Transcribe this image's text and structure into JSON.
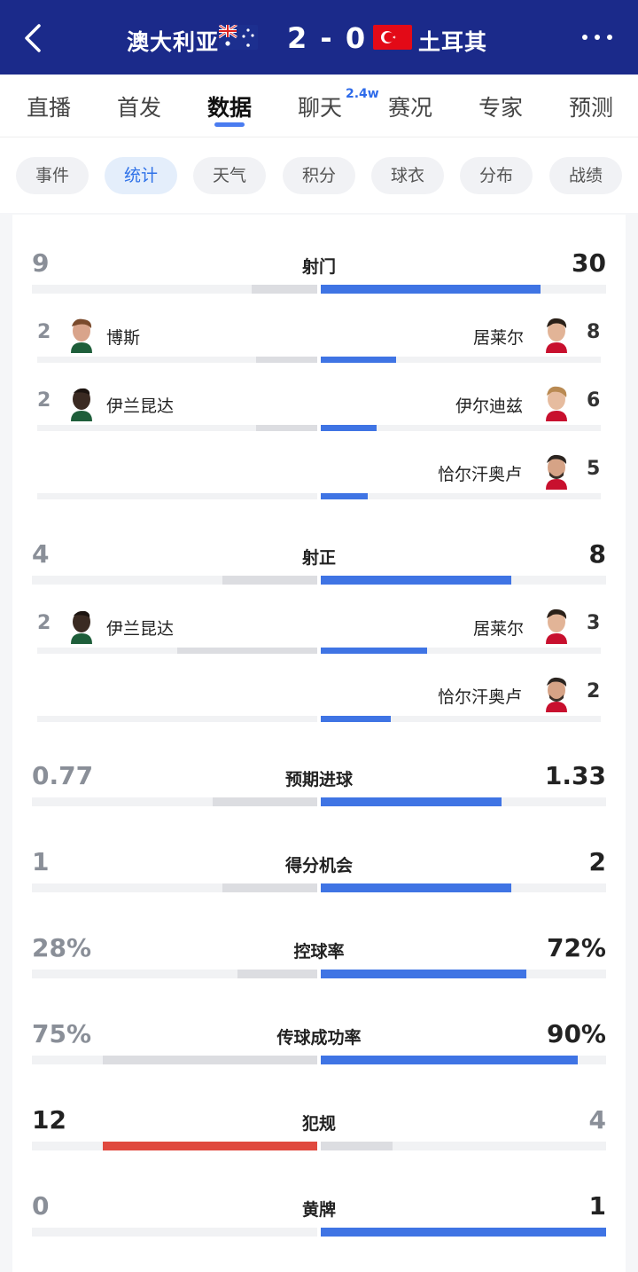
{
  "header": {
    "home_team": "澳大利亚",
    "away_team": "土耳其",
    "score": "2 - 0",
    "back_icon": "back-arrow-icon",
    "more_icon": "more-dots-icon"
  },
  "tabs": [
    {
      "label": "直播"
    },
    {
      "label": "首发"
    },
    {
      "label": "数据",
      "active": true
    },
    {
      "label": "聊天",
      "badge": "2.4w"
    },
    {
      "label": "赛况"
    },
    {
      "label": "专家"
    },
    {
      "label": "预测"
    }
  ],
  "subtabs": [
    {
      "label": "事件"
    },
    {
      "label": "统计",
      "active": true
    },
    {
      "label": "天气"
    },
    {
      "label": "积分"
    },
    {
      "label": "球衣"
    },
    {
      "label": "分布"
    },
    {
      "label": "战绩"
    }
  ],
  "colors": {
    "header_bg": "#1b2a8a",
    "accent_blue": "#3f74e4",
    "foul_red": "#e0493e",
    "bar_gray": "#dcdde1"
  },
  "stats": [
    {
      "label": "射门",
      "home": "9",
      "away": "30",
      "players": [
        {
          "side": "home",
          "name": "博斯",
          "count": "2"
        },
        {
          "side": "away",
          "name": "居莱尔",
          "count": "8"
        },
        {
          "side": "home",
          "name": "伊兰昆达",
          "count": "2"
        },
        {
          "side": "away",
          "name": "伊尔迪兹",
          "count": "6"
        },
        {
          "side": "away",
          "name": "恰尔汗奥卢",
          "count": "5"
        }
      ]
    },
    {
      "label": "射正",
      "home": "4",
      "away": "8",
      "players": [
        {
          "side": "home",
          "name": "伊兰昆达",
          "count": "2"
        },
        {
          "side": "away",
          "name": "居莱尔",
          "count": "3"
        },
        {
          "side": "away",
          "name": "恰尔汗奥卢",
          "count": "2"
        }
      ]
    },
    {
      "label": "预期进球",
      "home": "0.77",
      "away": "1.33"
    },
    {
      "label": "得分机会",
      "home": "1",
      "away": "2"
    },
    {
      "label": "控球率",
      "home": "28%",
      "away": "72%"
    },
    {
      "label": "传球成功率",
      "home": "75%",
      "away": "90%"
    },
    {
      "label": "犯规",
      "home": "12",
      "away": "4"
    },
    {
      "label": "黄牌",
      "home": "0",
      "away": "1"
    }
  ]
}
